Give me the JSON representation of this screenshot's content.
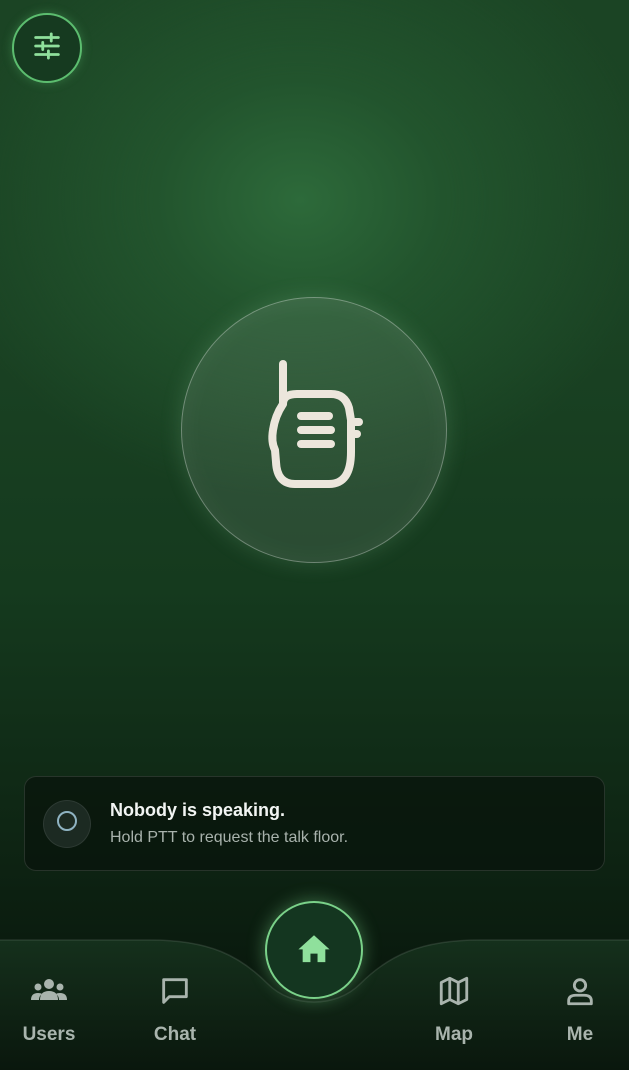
{
  "colors": {
    "accent": "#7ad189",
    "icon_light": "#ece6dc",
    "nav_gray": "#a9b4ad",
    "card_bg": "#0b1a0f"
  },
  "icons": {
    "settings": "sliders-icon",
    "ptt": "walkie-talkie-icon",
    "status": "idle-ring-icon",
    "home": "home-icon"
  },
  "status": {
    "title": "Nobody is speaking.",
    "subtitle": "Hold PTT to request the talk floor."
  },
  "nav": {
    "items": [
      {
        "label": "Users",
        "icon": "users-icon"
      },
      {
        "label": "Chat",
        "icon": "chat-bubble-icon"
      },
      {
        "label": "Map",
        "icon": "map-icon"
      },
      {
        "label": "Me",
        "icon": "person-icon"
      }
    ]
  }
}
